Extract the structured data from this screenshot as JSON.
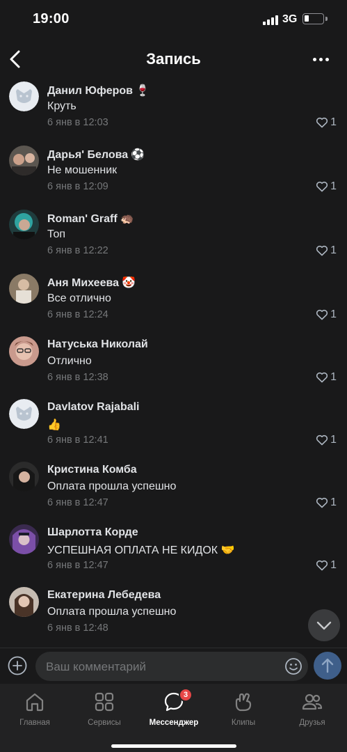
{
  "status_bar": {
    "time": "19:00",
    "network": "3G"
  },
  "header": {
    "title": "Запись"
  },
  "comments": [
    {
      "author": "Данил Юферов",
      "emoji": "🍷",
      "text": "Круть",
      "time": "6 янв в 12:03",
      "likes": "1",
      "avatar": "default-avatar-icon"
    },
    {
      "author": "Дарья' Белова",
      "emoji": "⚽",
      "text": "Не мошенник",
      "time": "6 янв в 12:09",
      "likes": "1",
      "avatar": "user-photo"
    },
    {
      "author": "Roman' Graff",
      "emoji": "🦔",
      "text": "Топ",
      "time": "6 янв в 12:22",
      "likes": "1",
      "avatar": "user-photo"
    },
    {
      "author": "Аня Михеева",
      "emoji": "🤡",
      "text": "Все отлично",
      "time": "6 янв в 12:24",
      "likes": "1",
      "avatar": "user-photo"
    },
    {
      "author": "Натуська Николай",
      "emoji": "",
      "text": "Отлично",
      "time": "6 янв в 12:38",
      "likes": "1",
      "avatar": "user-photo"
    },
    {
      "author": "Davlatov Rajabali",
      "emoji": "",
      "text": "👍",
      "time": "6 янв в 12:41",
      "likes": "1",
      "avatar": "default-avatar-icon"
    },
    {
      "author": "Кристина Комба",
      "emoji": "",
      "text": "Оплата прошла успешно",
      "time": "6 янв в 12:47",
      "likes": "1",
      "avatar": "user-photo"
    },
    {
      "author": "Шарлотта Корде",
      "emoji": "",
      "text": "УСПЕШНАЯ ОПЛАТА НЕ КИДОК 🤝",
      "time": "6 янв в 12:47",
      "likes": "1",
      "avatar": "user-photo"
    },
    {
      "author": "Екатерина Лебедева",
      "emoji": "",
      "text": "Оплата прошла успешно",
      "time": "6 янв в 12:48",
      "likes": "",
      "avatar": "user-photo"
    }
  ],
  "composer": {
    "placeholder": "Ваш комментарий"
  },
  "tabs": [
    {
      "label": "Главная",
      "icon": "home-icon",
      "active": false
    },
    {
      "label": "Сервисы",
      "icon": "services-icon",
      "active": false
    },
    {
      "label": "Мессенджер",
      "icon": "messenger-icon",
      "active": true,
      "badge": "3"
    },
    {
      "label": "Клипы",
      "icon": "clips-icon",
      "active": false
    },
    {
      "label": "Друзья",
      "icon": "friends-icon",
      "active": false
    }
  ],
  "colors": {
    "background": "#19191a",
    "text": "#e1e3e6",
    "secondary": "#76787a",
    "accent": "#3f5f8a",
    "badge": "#e64646"
  }
}
